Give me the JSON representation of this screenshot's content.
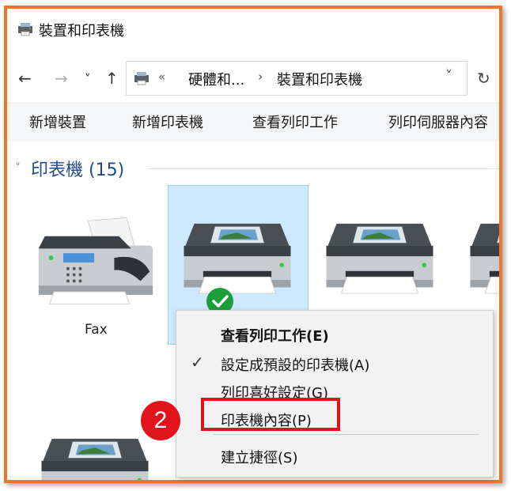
{
  "window": {
    "title": "裝置和印表機"
  },
  "nav": {
    "back_icon": "←",
    "forward_icon": "→",
    "recent_icon": "˅",
    "up_icon": "↑"
  },
  "address": {
    "separator": "«",
    "crumbs": [
      "硬體和...",
      "裝置和印表機"
    ],
    "crumb_arrow": "›",
    "dropdown_icon": "˅",
    "refresh_icon": "↻"
  },
  "commands": [
    "新增裝置",
    "新增印表機",
    "查看列印工作",
    "列印伺服器內容"
  ],
  "group": {
    "chevron": "˅",
    "title": "印表機 (15)"
  },
  "items": [
    {
      "label": "Fax",
      "icon": "fax-icon"
    },
    {
      "label": "",
      "icon": "printer-icon",
      "default": true
    },
    {
      "label": "",
      "icon": "printer-icon"
    },
    {
      "label": "",
      "icon": "printer-icon"
    },
    {
      "label": "",
      "icon": "printer-icon"
    }
  ],
  "context_menu": {
    "items": [
      {
        "label": "查看列印工作(E)",
        "bold": true,
        "checked": false
      },
      {
        "label": "設定成預設的印表機(A)",
        "bold": false,
        "checked": true
      },
      {
        "label": "列印喜好設定(G)",
        "bold": false,
        "checked": false
      },
      {
        "label": "印表機內容(P)",
        "bold": false,
        "checked": false,
        "highlighted": true
      },
      {
        "label": "建立捷徑(S)",
        "bold": false,
        "checked": false
      }
    ],
    "check_glyph": "✓"
  },
  "annotation": {
    "step": "2"
  },
  "colors": {
    "frame": "#f0752a",
    "highlight": "#e0141a",
    "selection": "#cde8ff",
    "group_title": "#1f4a8a",
    "check_green": "#1e9e3a"
  }
}
